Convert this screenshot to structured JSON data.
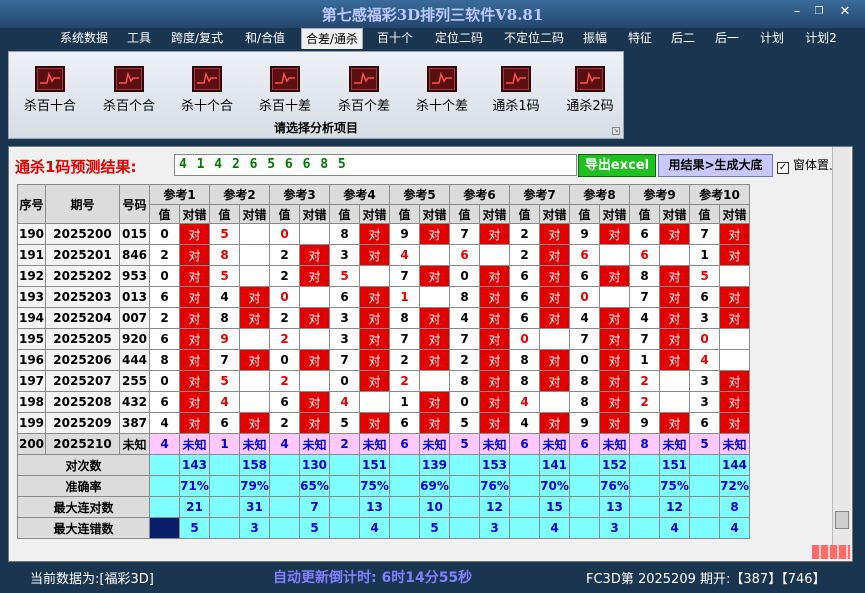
{
  "window": {
    "title": "第七感福彩3D排列三软件V8.81"
  },
  "menu": [
    "系统数据",
    "工具",
    "跨度/复式",
    "和/合值",
    "合差/通杀",
    "百十个",
    "定位二码",
    "不定位二码",
    "振幅",
    "特征",
    "后二",
    "后一",
    "计划",
    "计划2"
  ],
  "menu_active": "合差/通杀",
  "ribbon": {
    "buttons": [
      "杀百十合",
      "杀百个合",
      "杀十个合",
      "杀百十差",
      "杀百个差",
      "杀十个差",
      "通杀1码",
      "通杀2码"
    ],
    "caption": "请选择分析项目"
  },
  "prediction": {
    "label": "通杀1码预测结果:",
    "value": "4 1 4 2 6 5 6 6 8 5",
    "export_button": "导出excel",
    "generate_button": "用结果>生成大底",
    "pin_checkbox": "窗体置上",
    "pin_checked": true
  },
  "table": {
    "col_seq": "序号",
    "col_issue": "期号",
    "col_code": "号码",
    "ref_headers": [
      "参考1",
      "参考2",
      "参考3",
      "参考4",
      "参考5",
      "参考6",
      "参考7",
      "参考8",
      "参考9",
      "参考10"
    ],
    "sub_value": "值",
    "sub_result": "对错",
    "dui": "对",
    "rows": [
      {
        "seq": "190",
        "issue": "2025200",
        "code": "015",
        "vals": [
          "0",
          "5",
          "0",
          "8",
          "9",
          "7",
          "2",
          "9",
          "6",
          "7"
        ],
        "dui": [
          true,
          false,
          false,
          true,
          true,
          true,
          true,
          true,
          true,
          true
        ]
      },
      {
        "seq": "191",
        "issue": "2025201",
        "code": "846",
        "vals": [
          "2",
          "8",
          "2",
          "3",
          "4",
          "6",
          "2",
          "6",
          "6",
          "1"
        ],
        "dui": [
          true,
          false,
          true,
          true,
          false,
          false,
          true,
          false,
          false,
          true
        ]
      },
      {
        "seq": "192",
        "issue": "2025202",
        "code": "953",
        "vals": [
          "0",
          "5",
          "2",
          "5",
          "7",
          "0",
          "6",
          "6",
          "8",
          "5"
        ],
        "dui": [
          true,
          false,
          true,
          false,
          true,
          true,
          true,
          true,
          true,
          false
        ]
      },
      {
        "seq": "193",
        "issue": "2025203",
        "code": "013",
        "vals": [
          "6",
          "4",
          "0",
          "6",
          "1",
          "8",
          "6",
          "0",
          "7",
          "6"
        ],
        "dui": [
          true,
          true,
          false,
          true,
          false,
          true,
          true,
          false,
          true,
          true
        ]
      },
      {
        "seq": "194",
        "issue": "2025204",
        "code": "007",
        "vals": [
          "2",
          "8",
          "2",
          "3",
          "8",
          "4",
          "6",
          "4",
          "4",
          "3"
        ],
        "dui": [
          true,
          true,
          true,
          true,
          true,
          true,
          true,
          true,
          true,
          true
        ]
      },
      {
        "seq": "195",
        "issue": "2025205",
        "code": "920",
        "vals": [
          "6",
          "9",
          "2",
          "3",
          "7",
          "7",
          "0",
          "7",
          "7",
          "0"
        ],
        "dui": [
          true,
          false,
          false,
          true,
          true,
          true,
          false,
          true,
          true,
          false
        ]
      },
      {
        "seq": "196",
        "issue": "2025206",
        "code": "444",
        "vals": [
          "8",
          "7",
          "0",
          "7",
          "2",
          "2",
          "8",
          "0",
          "1",
          "4"
        ],
        "dui": [
          true,
          true,
          true,
          true,
          true,
          true,
          true,
          true,
          true,
          false
        ]
      },
      {
        "seq": "197",
        "issue": "2025207",
        "code": "255",
        "vals": [
          "0",
          "5",
          "2",
          "0",
          "2",
          "8",
          "8",
          "8",
          "2",
          "3"
        ],
        "dui": [
          true,
          false,
          false,
          true,
          false,
          true,
          true,
          true,
          false,
          true
        ]
      },
      {
        "seq": "198",
        "issue": "2025208",
        "code": "432",
        "vals": [
          "6",
          "4",
          "6",
          "4",
          "1",
          "0",
          "4",
          "8",
          "2",
          "3"
        ],
        "dui": [
          true,
          false,
          true,
          false,
          true,
          true,
          false,
          true,
          false,
          true
        ]
      },
      {
        "seq": "199",
        "issue": "2025209",
        "code": "387",
        "vals": [
          "4",
          "6",
          "2",
          "5",
          "6",
          "5",
          "4",
          "9",
          "9",
          "6"
        ],
        "dui": [
          true,
          true,
          true,
          true,
          true,
          true,
          true,
          true,
          true,
          true
        ]
      }
    ],
    "predict_row": {
      "seq": "200",
      "issue": "2025210",
      "code": "未知",
      "vals": [
        "4",
        "1",
        "4",
        "2",
        "6",
        "5",
        "6",
        "6",
        "8",
        "5"
      ],
      "result": "未知"
    },
    "stats": [
      {
        "label": "对次数",
        "vals": [
          "143",
          "158",
          "130",
          "151",
          "139",
          "153",
          "141",
          "152",
          "151",
          "144"
        ]
      },
      {
        "label": "准确率",
        "vals": [
          "71%",
          "79%",
          "65%",
          "75%",
          "69%",
          "76%",
          "70%",
          "76%",
          "75%",
          "72%"
        ]
      },
      {
        "label": "最大连对数",
        "vals": [
          "21",
          "31",
          "7",
          "13",
          "10",
          "12",
          "15",
          "13",
          "12",
          "8"
        ]
      },
      {
        "label": "最大连错数",
        "vals": [
          "5",
          "3",
          "5",
          "4",
          "5",
          "3",
          "4",
          "3",
          "4",
          "4"
        ]
      }
    ]
  },
  "status": {
    "data_source": "当前数据为:[福彩3D]",
    "countdown": "自动更新倒计时: 6时14分55秒",
    "latest": "FC3D第 2025209 期开:【387】【746】"
  },
  "colors": {
    "hit": "#e00000",
    "predict_row": "#ffc8ff",
    "stats_row": "#80ffff",
    "export_btn": "#20c020"
  }
}
